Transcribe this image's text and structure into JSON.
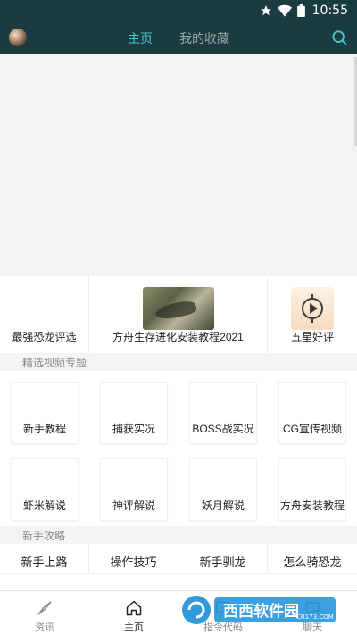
{
  "status_bar": {
    "time": "10:55"
  },
  "header": {
    "tabs": [
      {
        "label": "主页",
        "active": true
      },
      {
        "label": "我的收藏",
        "active": false
      }
    ],
    "accent": "#45c7d6",
    "bg": "#1a3c40"
  },
  "featured": {
    "items": [
      {
        "label": "最强恐龙评选"
      },
      {
        "label": "方舟生存进化安装教程2021"
      },
      {
        "label": "五星好评"
      }
    ]
  },
  "video_section": {
    "title": "精选视频专题",
    "items": [
      {
        "label": "新手教程"
      },
      {
        "label": "捕获实况"
      },
      {
        "label": "BOSS战实况"
      },
      {
        "label": "CG宣传视频"
      },
      {
        "label": "虾米解说"
      },
      {
        "label": "神评解说"
      },
      {
        "label": "妖月解说"
      },
      {
        "label": "方舟安装教程"
      }
    ]
  },
  "guide_section": {
    "title": "新手攻略",
    "items": [
      {
        "label": "新手上路"
      },
      {
        "label": "操作技巧"
      },
      {
        "label": "新手驯龙"
      },
      {
        "label": "怎么骑恐龙"
      }
    ]
  },
  "bottom_nav": {
    "items": [
      {
        "label": "资讯",
        "icon": "compass-icon"
      },
      {
        "label": "主页",
        "icon": "home-icon",
        "active": true
      },
      {
        "label": "指令代码",
        "icon": "code-icon"
      },
      {
        "label": "聊天",
        "icon": "chat-icon"
      }
    ]
  },
  "watermark": {
    "text": "西西软件园",
    "url": "CR173.COM"
  }
}
